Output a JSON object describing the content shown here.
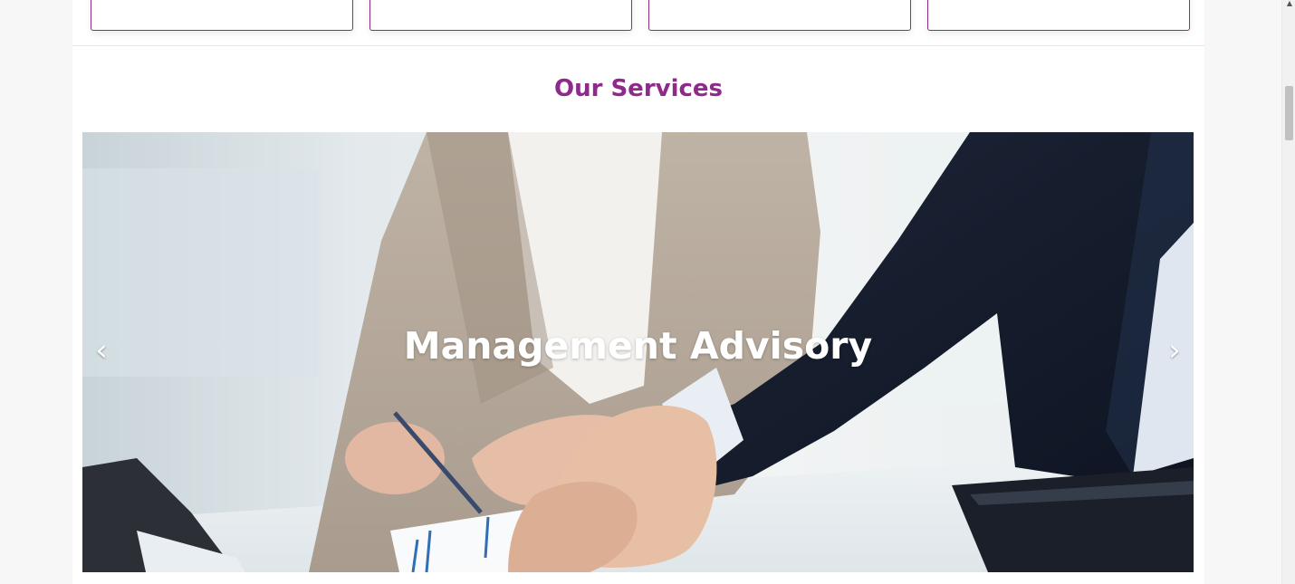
{
  "cards": [
    {
      "id": "card-1"
    },
    {
      "id": "card-2"
    },
    {
      "id": "card-3"
    },
    {
      "id": "card-4"
    }
  ],
  "services": {
    "title": "Our Services",
    "carousel": {
      "caption": "Management Advisory",
      "prev_label": "‹",
      "next_label": "›",
      "image_alt": "Business handshake photo"
    }
  },
  "colors": {
    "accent": "#8e2a8a",
    "caption": "#ffffff"
  },
  "icons": [
    "chevron-left-icon",
    "chevron-right-icon",
    "scroll-up-arrow-icon"
  ]
}
